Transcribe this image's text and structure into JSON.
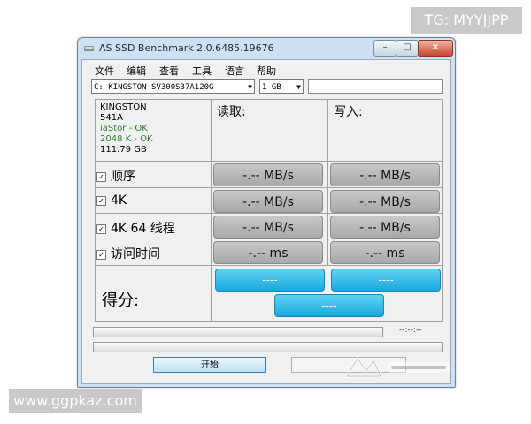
{
  "watermarks": {
    "top": "TG: MYYJJPP",
    "bottom": "www.ggpkaz.com"
  },
  "window": {
    "title": "AS SSD Benchmark 2.0.6485.19676"
  },
  "menu": [
    "文件",
    "编辑",
    "查看",
    "工具",
    "语言",
    "帮助"
  ],
  "drive_select": {
    "value": "C: KINGSTON SV300S37A120G"
  },
  "size_select": {
    "value": "1 GB"
  },
  "drive_info": [
    "KINGSTON",
    "541A",
    "iaStor - OK",
    "2048 K - OK",
    "111.79 GB"
  ],
  "columns": {
    "read": "读取:",
    "write": "写入:"
  },
  "tests": [
    {
      "label": "顺序",
      "read": "-.-- MB/s",
      "write": "-.-- MB/s",
      "checked": true
    },
    {
      "label": "4K",
      "read": "-.-- MB/s",
      "write": "-.-- MB/s",
      "checked": true
    },
    {
      "label": "4K 64 线程",
      "read": "-.-- MB/s",
      "write": "-.-- MB/s",
      "checked": true
    },
    {
      "label": "访问时间",
      "read": "-.-- ms",
      "write": "-.-- ms",
      "checked": true
    }
  ],
  "score": {
    "label": "得分:",
    "read": "----",
    "write": "----",
    "total": "----"
  },
  "timer": "--:--:--",
  "buttons": {
    "start": "开始"
  },
  "colors": {
    "score_fill": "#1aa8dd",
    "result_fill": "#b4b4b4",
    "ok_text": "#2e7d2e"
  }
}
